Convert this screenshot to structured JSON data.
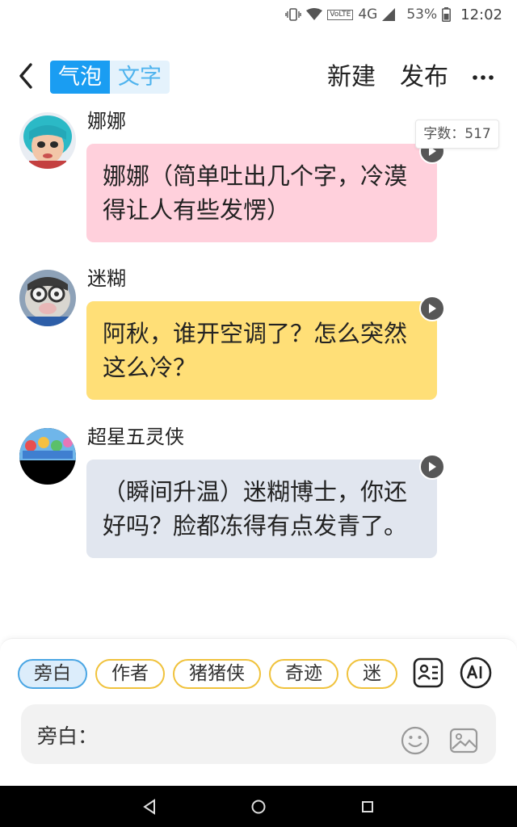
{
  "status_bar": {
    "network": "4G",
    "volte": "VoLTE",
    "battery": "53%",
    "time": "12:02"
  },
  "header": {
    "mode_active": "气泡",
    "mode_inactive": "文字",
    "new_label": "新建",
    "publish_label": "发布"
  },
  "word_count": "字数：517",
  "messages": [
    {
      "sender": "娜娜",
      "text": "娜娜（简单吐出几个字，冷漠得让人有些发愣）",
      "bubble_color": "#ffd0dc"
    },
    {
      "sender": "迷糊",
      "text": "阿秋，谁开空调了？怎么突然这么冷？",
      "bubble_color": "#ffdf77"
    },
    {
      "sender": "超星五灵侠",
      "text": "（瞬间升温）迷糊博士，你还好吗？脸都冻得有点发青了。",
      "bubble_color": "#e1e6ef"
    }
  ],
  "roles": [
    "旁白",
    "作者",
    "猪猪侠",
    "奇迹",
    "迷"
  ],
  "input": {
    "label": "旁白：",
    "value": ""
  },
  "icons": {
    "back": "back-arrow-icon",
    "more": "more-icon",
    "play": "play-icon",
    "card": "character-card-icon",
    "ai": "ai-icon",
    "emoji": "emoji-icon",
    "image": "image-icon"
  },
  "colors": {
    "accent": "#1a9df2",
    "chip_border": "#f0c23c",
    "chip_selected_bg": "#dcedfb"
  }
}
